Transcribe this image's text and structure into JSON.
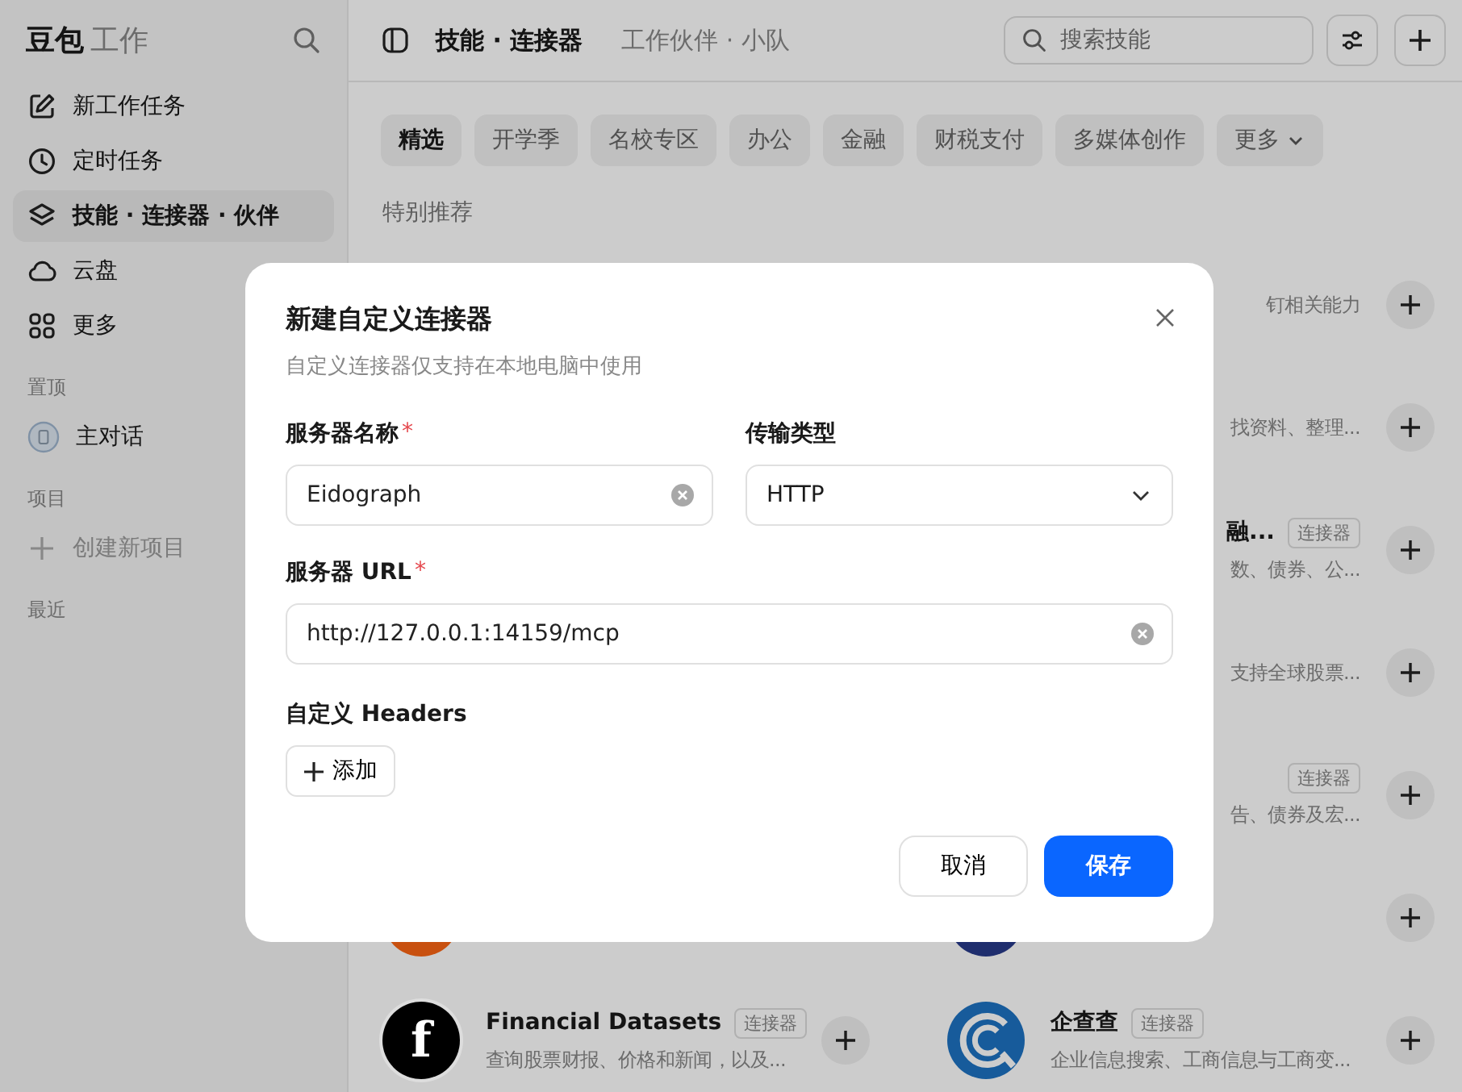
{
  "sidebar": {
    "brand": "豆包",
    "brand_suffix": "工作",
    "nav": [
      {
        "label": "新工作任务",
        "selected": false
      },
      {
        "label": "定时任务",
        "selected": false
      },
      {
        "label": "技能 · 连接器 · 伙伴",
        "selected": true
      },
      {
        "label": "云盘",
        "selected": false
      },
      {
        "label": "更多",
        "selected": false
      }
    ],
    "sections": [
      {
        "title": "置顶",
        "items": [
          {
            "label": "主对话",
            "disabled": false
          }
        ]
      },
      {
        "title": "项目",
        "items": [
          {
            "label": "创建新项目",
            "disabled": true
          }
        ]
      },
      {
        "title": "最近"
      }
    ]
  },
  "header": {
    "tabs": [
      {
        "label": "技能 · 连接器",
        "selected": true
      },
      {
        "label": "工作伙伴 · 小队",
        "selected": false
      }
    ],
    "search": {
      "placeholder": "搜索技能"
    }
  },
  "categories": [
    {
      "label": "精选",
      "selected": true,
      "kind": "chip"
    },
    {
      "label": "开学季",
      "selected": false,
      "kind": "chip"
    },
    {
      "label": "名校专区",
      "selected": false,
      "kind": "chip"
    },
    {
      "label": "办公",
      "selected": false,
      "kind": "chip"
    },
    {
      "label": "金融",
      "selected": false,
      "kind": "chip"
    },
    {
      "label": "财税支付",
      "selected": false,
      "kind": "chip"
    },
    {
      "label": "多媒体创作",
      "selected": false,
      "kind": "chip"
    },
    {
      "label": "更多",
      "selected": false,
      "kind": "menu"
    }
  ],
  "section_title": "特别推荐",
  "rows": [
    {
      "right": {
        "kind": "fragment",
        "description": "钉相关能力"
      }
    },
    {
      "right": {
        "kind": "fragment",
        "description": "找资料、整理..."
      }
    },
    {
      "right": {
        "kind": "fragment",
        "title": "融...",
        "tag": "连接器",
        "description": "数、债券、公..."
      }
    },
    {
      "right": {
        "kind": "fragment",
        "description": "支持全球股票..."
      }
    },
    {
      "right": {
        "kind": "fragment",
        "tag": "连接器",
        "description": "告、债券及宏..."
      }
    },
    {
      "left": {
        "kind": "peek",
        "color": "#c8500f"
      },
      "right": {
        "kind": "peek",
        "color": "#1f2e6e"
      }
    },
    {
      "left": {
        "kind": "full",
        "logo_text": "f",
        "title": "Financial Datasets",
        "tag": "连接器",
        "description": "查询股票财报、价格和新闻，以及..."
      },
      "right": {
        "kind": "full",
        "title": "企查查",
        "tag": "连接器",
        "description": "企业信息搜索、工商信息与工商变..."
      }
    }
  ],
  "dialog": {
    "title": "新建自定义连接器",
    "subtitle": "自定义连接器仅支持在本地电脑中使用",
    "fields": [
      {
        "kind": "text",
        "label": "服务器名称",
        "required_mark": "*",
        "value": "Eidograph"
      },
      {
        "kind": "select",
        "label": "传输类型",
        "value": "HTTP"
      },
      {
        "kind": "text",
        "label": "服务器 URL",
        "required_mark": "*",
        "value": "http://127.0.0.1:14159/mcp"
      }
    ],
    "headers_label": "自定义 Headers",
    "add_button": "添加",
    "cancel_button": "取消",
    "save_button": "保存"
  }
}
